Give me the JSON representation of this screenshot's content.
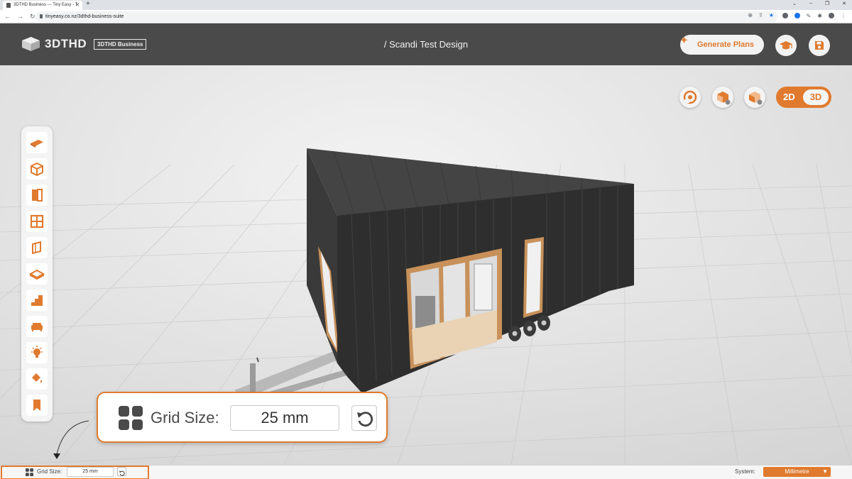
{
  "browser": {
    "tab_title": "3DTHD Business — Tiny Easy - T",
    "url": "tinyeasy.co.nz/3dthd-business-suite"
  },
  "header": {
    "brand": "3DTHD",
    "badge": "3DTHD Business",
    "design_title": "/ Scandi Test Design",
    "generate_plans_label": "Generate Plans"
  },
  "view_toggle": {
    "option_2d": "2D",
    "option_3d": "3D",
    "active": "3D"
  },
  "left_toolbar": {
    "items": [
      "roof-icon",
      "cube-icon",
      "door-icon",
      "window-icon",
      "wall-panel-icon",
      "floor-icon",
      "stairs-icon",
      "sofa-icon",
      "lightbulb-icon",
      "paint-bucket-icon",
      "bookmark-icon"
    ]
  },
  "callout": {
    "label": "Grid Size:",
    "value": "25 mm"
  },
  "status_bar": {
    "grid_label": "Grid Size:",
    "grid_value": "25 mm",
    "system_label": "System:",
    "system_value": "Millimetre"
  },
  "colors": {
    "accent": "#e07a2e",
    "header_bg": "#4a4a4a",
    "house_cladding": "#2e2e2e"
  }
}
